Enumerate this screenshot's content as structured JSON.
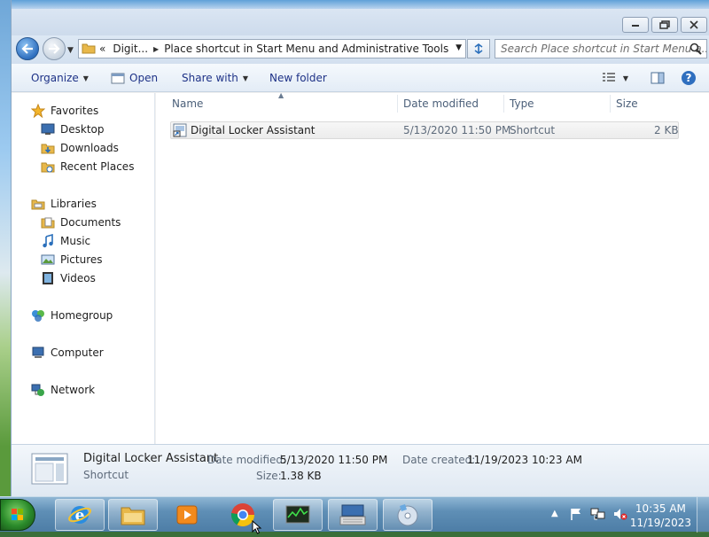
{
  "window": {
    "breadcrumb": [
      "Digit...",
      "Place shortcut in Start Menu and Administrative Tools"
    ],
    "breadcrumb_prefix": "«",
    "search_placeholder": "Search Place shortcut in Start Menu a..."
  },
  "toolbar": {
    "organize": "Organize",
    "open": "Open",
    "share_with": "Share with",
    "new_folder": "New folder"
  },
  "navpane": {
    "favorites": "Favorites",
    "favorites_items": [
      "Desktop",
      "Downloads",
      "Recent Places"
    ],
    "libraries": "Libraries",
    "libraries_items": [
      "Documents",
      "Music",
      "Pictures",
      "Videos"
    ],
    "homegroup": "Homegroup",
    "computer": "Computer",
    "network": "Network"
  },
  "columns": {
    "name": "Name",
    "date_modified": "Date modified",
    "type": "Type",
    "size": "Size"
  },
  "files": [
    {
      "name": "Digital Locker Assistant",
      "date_modified": "5/13/2020 11:50 PM",
      "type": "Shortcut",
      "size": "2 KB"
    }
  ],
  "details": {
    "name": "Digital Locker Assistant",
    "kind": "Shortcut",
    "date_modified_label": "Date modified:",
    "date_modified": "5/13/2020 11:50 PM",
    "size_label": "Size:",
    "size": "1.38 KB",
    "date_created_label": "Date created:",
    "date_created": "11/19/2023 10:23 AM"
  },
  "taskbar": {
    "apps": [
      "internet-explorer-icon",
      "windows-explorer-icon",
      "media-player-icon",
      "chrome-icon",
      "task-manager-icon",
      "keyboard-app-icon",
      "disc-burner-icon"
    ],
    "time": "10:35 AM",
    "date": "11/19/2023"
  }
}
